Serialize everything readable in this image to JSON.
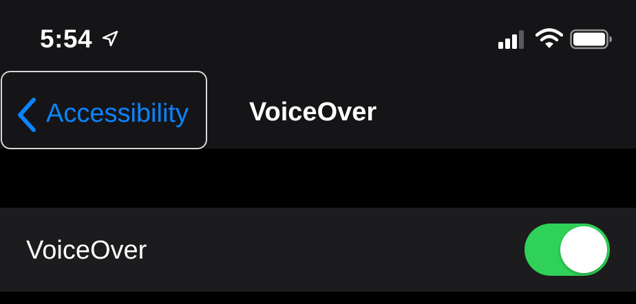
{
  "status_bar": {
    "time": "5:54",
    "location_icon": "location-arrow-icon",
    "signal_icon": "cellular-signal-icon",
    "wifi_icon": "wifi-icon",
    "battery_icon": "battery-icon"
  },
  "nav": {
    "back_label": "Accessibility",
    "back_icon": "chevron-left-icon",
    "title": "VoiceOver"
  },
  "settings": {
    "voiceover_row": {
      "label": "VoiceOver",
      "toggle_on": true
    }
  },
  "colors": {
    "background": "#000000",
    "nav_background": "#151517",
    "cell_background": "#1c1c1e",
    "accent": "#0a84ff",
    "toggle_on": "#30d158",
    "text": "#ffffff"
  }
}
